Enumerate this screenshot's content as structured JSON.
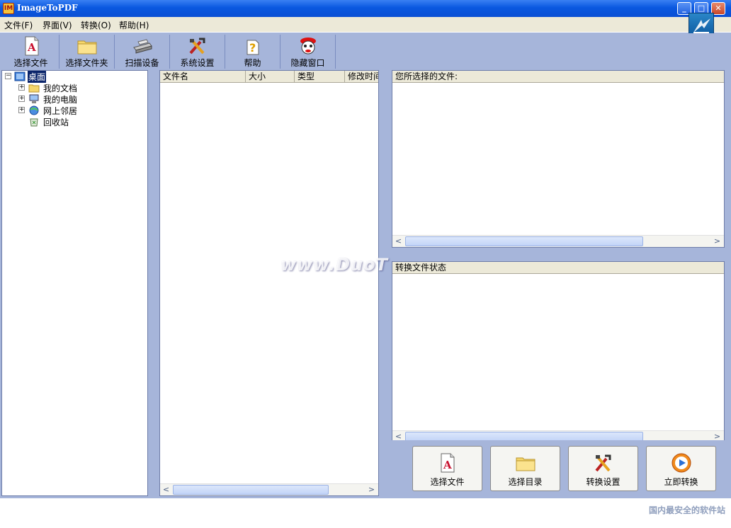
{
  "window": {
    "title": "ImageToPDF",
    "app_icon_text": "IM",
    "controls": {
      "minimize": "_",
      "maximize": "□",
      "close": "✕"
    }
  },
  "menubar": {
    "items": [
      "文件(F)",
      "界面(V)",
      "转换(O)",
      "帮助(H)"
    ]
  },
  "toolbar": {
    "buttons": [
      {
        "label": "选择文件",
        "icon": "pdf-file-icon"
      },
      {
        "label": "选择文件夹",
        "icon": "folder-icon"
      },
      {
        "label": "扫描设备",
        "icon": "scanner-icon"
      },
      {
        "label": "系统设置",
        "icon": "tools-icon"
      },
      {
        "label": "帮助",
        "icon": "help-icon"
      },
      {
        "label": "隐藏窗口",
        "icon": "mascot-icon"
      }
    ]
  },
  "tree": {
    "root": "桌面",
    "children": [
      "我的文档",
      "我的电脑",
      "网上邻居",
      "回收站"
    ]
  },
  "file_list": {
    "columns": [
      "文件名",
      "大小",
      "类型",
      "修改时间"
    ],
    "rows": []
  },
  "selected_panel": {
    "header": "您所选择的文件:"
  },
  "status_panel": {
    "header": "转换文件状态"
  },
  "actions": {
    "buttons": [
      {
        "label": "选择文件",
        "icon": "pdf-file-icon"
      },
      {
        "label": "选择目录",
        "icon": "folder-icon"
      },
      {
        "label": "转换设置",
        "icon": "tools-icon"
      },
      {
        "label": "立即转换",
        "icon": "convert-play-icon"
      }
    ]
  },
  "watermark": {
    "center_text": "www.DuoT",
    "site_text": "国内最安全的软件站"
  },
  "scroll_arrows": {
    "left": "<",
    "right": ">"
  },
  "colors": {
    "titlebar": "#0a58e0",
    "panel_bg": "#a6b5da",
    "menubar": "#ece9d8",
    "selection": "#0a246a"
  }
}
